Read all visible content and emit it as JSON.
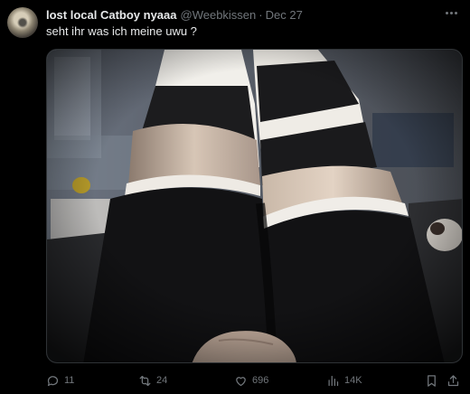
{
  "tweet": {
    "author_name": "lost local Catboy nyaaa",
    "author_handle": "@Weebkissen",
    "separator": "·",
    "date": "Dec 27",
    "text": "seht ihr was ich meine uwu ?"
  },
  "actions": {
    "replies": "11",
    "reposts": "24",
    "likes": "696",
    "views": "14K"
  },
  "icons": {
    "more": "more-options-icon",
    "reply": "reply-icon",
    "repost": "repost-icon",
    "like": "heart-icon",
    "views": "views-chart-icon",
    "bookmark": "bookmark-icon",
    "share": "share-icon"
  },
  "colors": {
    "background": "#000000",
    "text_primary": "#e7e9ea",
    "text_secondary": "#71767b",
    "border": "#2f3336"
  }
}
